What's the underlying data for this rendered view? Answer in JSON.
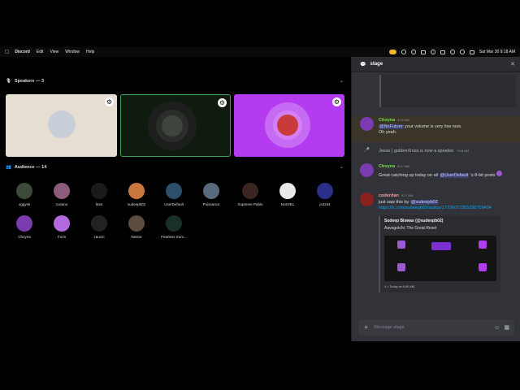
{
  "menubar": {
    "app_name": "Discord",
    "items": [
      "Edit",
      "View",
      "Window",
      "Help"
    ],
    "clock": "Sat Mar 30  9:18 AM"
  },
  "stage": {
    "speakers_header": "Speakers — 3",
    "audience_header": "Audience — 14",
    "speakers": [
      {
        "bg": "#e6ddd3"
      },
      {
        "bg": "#101b10"
      },
      {
        "bg": "#b53bf0"
      }
    ],
    "audience": [
      {
        "name": "oggysk",
        "color": "#3d4a3a"
      },
      {
        "name": "roxiano",
        "color": "#8d5c7a"
      },
      {
        "name": "fase",
        "color": "#1a1a1a"
      },
      {
        "name": "sudeepb02",
        "color": "#c9773e"
      },
      {
        "name": "UserDefault",
        "color": "#2c4f6b"
      },
      {
        "name": "Puissance",
        "color": "#5a6a7d"
      },
      {
        "name": "Supreme Pablo",
        "color": "#3b2521"
      },
      {
        "name": "NADIEL",
        "color": "#e9e9e9"
      },
      {
        "name": "js3234",
        "color": "#2b2f8a"
      },
      {
        "name": "Choyna",
        "color": "#7a3bb0"
      },
      {
        "name": "Forin",
        "color": "#b36ae0"
      },
      {
        "name": "zaunzi",
        "color": "#222"
      },
      {
        "name": "Nestor",
        "color": "#5d4c3f"
      },
      {
        "name": "Fearless Sum...",
        "color": "#183028"
      }
    ]
  },
  "sidebar": {
    "channel": "stage",
    "messages": [
      {
        "user": "Choyna",
        "time": "9:16 AM",
        "mention": "@NoFuture",
        "text": "your volume is very low now.",
        "text2": "Oh yeah."
      },
      {
        "system": "Jesse | goldenXross is now a speaker.",
        "time": "9:16 AM"
      },
      {
        "user": "Choyna",
        "time": "9:17 AM",
        "text_pre": "Great catching up today on all",
        "mention": "@UserDefault",
        "text_post": "'s 8-bit posts"
      },
      {
        "user": "coderdan",
        "time": "9:17 AM",
        "text_pre": "just saw this by",
        "mention": "@sudeepb02",
        "link": "https://x.com/sudeepb02/status/17706072265295709404",
        "embed_author": "Sudeep Biswas (@sudeepb02)",
        "embed_title": "Aavegotchi: The Great Reset",
        "embed_footer": "X • Today at 8:59 AM"
      }
    ],
    "input_placeholder": "Message  stage"
  }
}
